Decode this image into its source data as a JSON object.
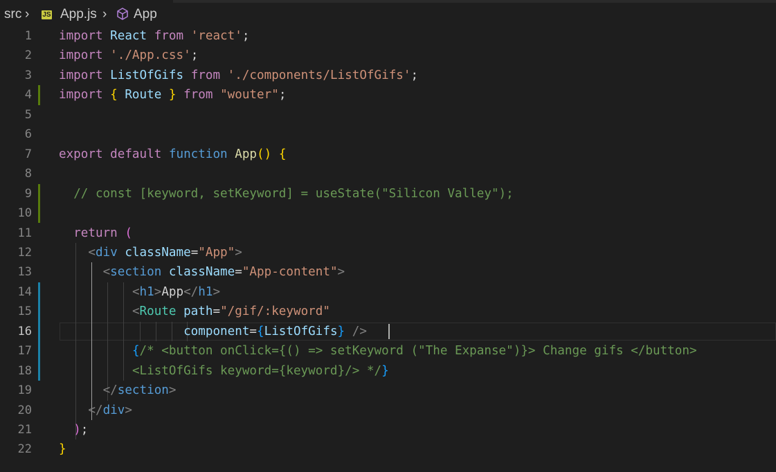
{
  "breadcrumb": {
    "folder": "src",
    "file_badge": "JS",
    "file": "App.js",
    "symbol": "App"
  },
  "editor": {
    "current_line": 16,
    "lines": [
      {
        "n": "1",
        "tokens": [
          [
            "k",
            "import"
          ],
          [
            "p",
            " "
          ],
          [
            "v",
            "React"
          ],
          [
            "p",
            " "
          ],
          [
            "k",
            "from"
          ],
          [
            "p",
            " "
          ],
          [
            "s",
            "'react'"
          ],
          [
            "p",
            ";"
          ]
        ]
      },
      {
        "n": "2",
        "tokens": [
          [
            "k",
            "import"
          ],
          [
            "p",
            " "
          ],
          [
            "s",
            "'./App.css'"
          ],
          [
            "p",
            ";"
          ]
        ]
      },
      {
        "n": "3",
        "tokens": [
          [
            "k",
            "import"
          ],
          [
            "p",
            " "
          ],
          [
            "v",
            "ListOfGifs"
          ],
          [
            "p",
            " "
          ],
          [
            "k",
            "from"
          ],
          [
            "p",
            " "
          ],
          [
            "s",
            "'./components/ListOfGifs'"
          ],
          [
            "p",
            ";"
          ]
        ]
      },
      {
        "n": "4",
        "tokens": [
          [
            "k",
            "import"
          ],
          [
            "p",
            " "
          ],
          [
            "y",
            "{"
          ],
          [
            "p",
            " "
          ],
          [
            "v",
            "Route"
          ],
          [
            "p",
            " "
          ],
          [
            "y",
            "}"
          ],
          [
            "p",
            " "
          ],
          [
            "k",
            "from"
          ],
          [
            "p",
            " "
          ],
          [
            "s",
            "\"wouter\""
          ],
          [
            "p",
            ";"
          ]
        ]
      },
      {
        "n": "5",
        "tokens": []
      },
      {
        "n": "6",
        "tokens": []
      },
      {
        "n": "7",
        "tokens": [
          [
            "k",
            "export"
          ],
          [
            "p",
            " "
          ],
          [
            "k",
            "default"
          ],
          [
            "p",
            " "
          ],
          [
            "kb",
            "function"
          ],
          [
            "p",
            " "
          ],
          [
            "f",
            "App"
          ],
          [
            "y",
            "()"
          ],
          [
            "p",
            " "
          ],
          [
            "y",
            "{"
          ]
        ]
      },
      {
        "n": "8",
        "tokens": []
      },
      {
        "n": "9",
        "tokens": [
          [
            "p",
            "  "
          ],
          [
            "c",
            "// const [keyword, setKeyword] = useState(\"Silicon Valley\");"
          ]
        ]
      },
      {
        "n": "10",
        "tokens": []
      },
      {
        "n": "11",
        "tokens": [
          [
            "p",
            "  "
          ],
          [
            "k",
            "return"
          ],
          [
            "p",
            " "
          ],
          [
            "m",
            "("
          ]
        ]
      },
      {
        "n": "12",
        "tokens": [
          [
            "p",
            "    "
          ],
          [
            "tg",
            "<"
          ],
          [
            "kb",
            "div"
          ],
          [
            "p",
            " "
          ],
          [
            "v",
            "className"
          ],
          [
            "p",
            "="
          ],
          [
            "s",
            "\"App\""
          ],
          [
            "tg",
            ">"
          ]
        ]
      },
      {
        "n": "13",
        "tokens": [
          [
            "p",
            "      "
          ],
          [
            "tg",
            "<"
          ],
          [
            "kb",
            "section"
          ],
          [
            "p",
            " "
          ],
          [
            "v",
            "className"
          ],
          [
            "p",
            "="
          ],
          [
            "s",
            "\"App-content\""
          ],
          [
            "tg",
            ">"
          ]
        ]
      },
      {
        "n": "14",
        "tokens": [
          [
            "p",
            "          "
          ],
          [
            "tg",
            "<"
          ],
          [
            "kb",
            "h1"
          ],
          [
            "tg",
            ">"
          ],
          [
            "p",
            "App"
          ],
          [
            "tg",
            "</"
          ],
          [
            "kb",
            "h1"
          ],
          [
            "tg",
            ">"
          ]
        ]
      },
      {
        "n": "15",
        "tokens": [
          [
            "p",
            "          "
          ],
          [
            "tg",
            "<"
          ],
          [
            "t",
            "Route"
          ],
          [
            "p",
            " "
          ],
          [
            "v",
            "path"
          ],
          [
            "p",
            "="
          ],
          [
            "s",
            "\"/gif/:keyword\""
          ]
        ]
      },
      {
        "n": "16",
        "tokens": [
          [
            "p",
            "                 "
          ],
          [
            "v",
            "component"
          ],
          [
            "p",
            "="
          ],
          [
            "b",
            "{"
          ],
          [
            "v",
            "ListOfGifs"
          ],
          [
            "b",
            "}"
          ],
          [
            "p",
            " "
          ],
          [
            "tg",
            "/>"
          ]
        ]
      },
      {
        "n": "17",
        "tokens": [
          [
            "p",
            "          "
          ],
          [
            "b",
            "{"
          ],
          [
            "c",
            "/* <button onClick={() => setKeyword (\"The Expanse\")}> Change gifs </button>"
          ]
        ]
      },
      {
        "n": "18",
        "tokens": [
          [
            "p",
            "          "
          ],
          [
            "c",
            "<ListOfGifs keyword={keyword}/> */"
          ],
          [
            "b",
            "}"
          ]
        ]
      },
      {
        "n": "19",
        "tokens": [
          [
            "p",
            "      "
          ],
          [
            "tg",
            "</"
          ],
          [
            "kb",
            "section"
          ],
          [
            "tg",
            ">"
          ]
        ]
      },
      {
        "n": "20",
        "tokens": [
          [
            "p",
            "    "
          ],
          [
            "tg",
            "</"
          ],
          [
            "kb",
            "div"
          ],
          [
            "tg",
            ">"
          ]
        ]
      },
      {
        "n": "21",
        "tokens": [
          [
            "p",
            "  "
          ],
          [
            "m",
            ")"
          ],
          [
            "p",
            ";"
          ]
        ]
      },
      {
        "n": "22",
        "tokens": [
          [
            "y",
            "}"
          ]
        ]
      }
    ],
    "git_changes": [
      {
        "line": 4,
        "kind": "added"
      },
      {
        "line": 9,
        "kind": "added"
      },
      {
        "line": 10,
        "kind": "added"
      },
      {
        "line": 14,
        "kind": "modified"
      },
      {
        "line": 15,
        "kind": "modified"
      },
      {
        "line": 16,
        "kind": "modified"
      },
      {
        "line": 17,
        "kind": "modified"
      },
      {
        "line": 18,
        "kind": "modified"
      }
    ],
    "colors": {
      "background": "#1e1e1e",
      "keyword": "#c586c0",
      "storage": "#569cd6",
      "variable": "#9cdcfe",
      "function": "#dcdcaa",
      "string": "#ce9178",
      "comment": "#6a9955",
      "component": "#4ec9b0",
      "bracket_gold": "#ffd700",
      "bracket_orchid": "#da70d6",
      "bracket_blue": "#179fff",
      "added": "#587c0c",
      "modified": "#1b81a8"
    }
  }
}
